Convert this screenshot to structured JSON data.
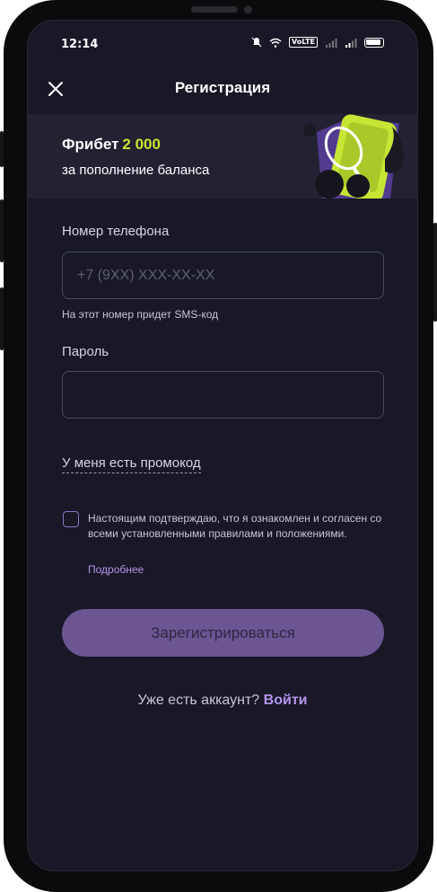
{
  "status": {
    "time": "12:14",
    "volte": "VoLTE"
  },
  "header": {
    "title": "Регистрация",
    "close_icon": "close-icon"
  },
  "banner": {
    "freebet_label": "Фрибет",
    "freebet_amount": "2 000",
    "subtitle": "за пополнение баланса",
    "accent_color": "#c7e534"
  },
  "form": {
    "phone": {
      "label": "Номер телефона",
      "placeholder": "+7 (9XX) XXX-XX-XX",
      "value": "",
      "hint": "На этот номер придет SMS-код"
    },
    "password": {
      "label": "Пароль",
      "placeholder": "",
      "value": ""
    },
    "promo_link": "У меня есть промокод",
    "agreement": {
      "checked": false,
      "text": "Настоящим подтверждаю, что я ознакомлен и согласен со всеми установленными правилами и положениями.",
      "more_link": "Подробнее"
    },
    "submit_label": "Зарегистрироваться"
  },
  "footer": {
    "prompt": "Уже есть аккаунт?",
    "login_link": "Войти"
  },
  "colors": {
    "background": "#181826",
    "primary_button": "#6b5593",
    "link": "#b694f0"
  }
}
